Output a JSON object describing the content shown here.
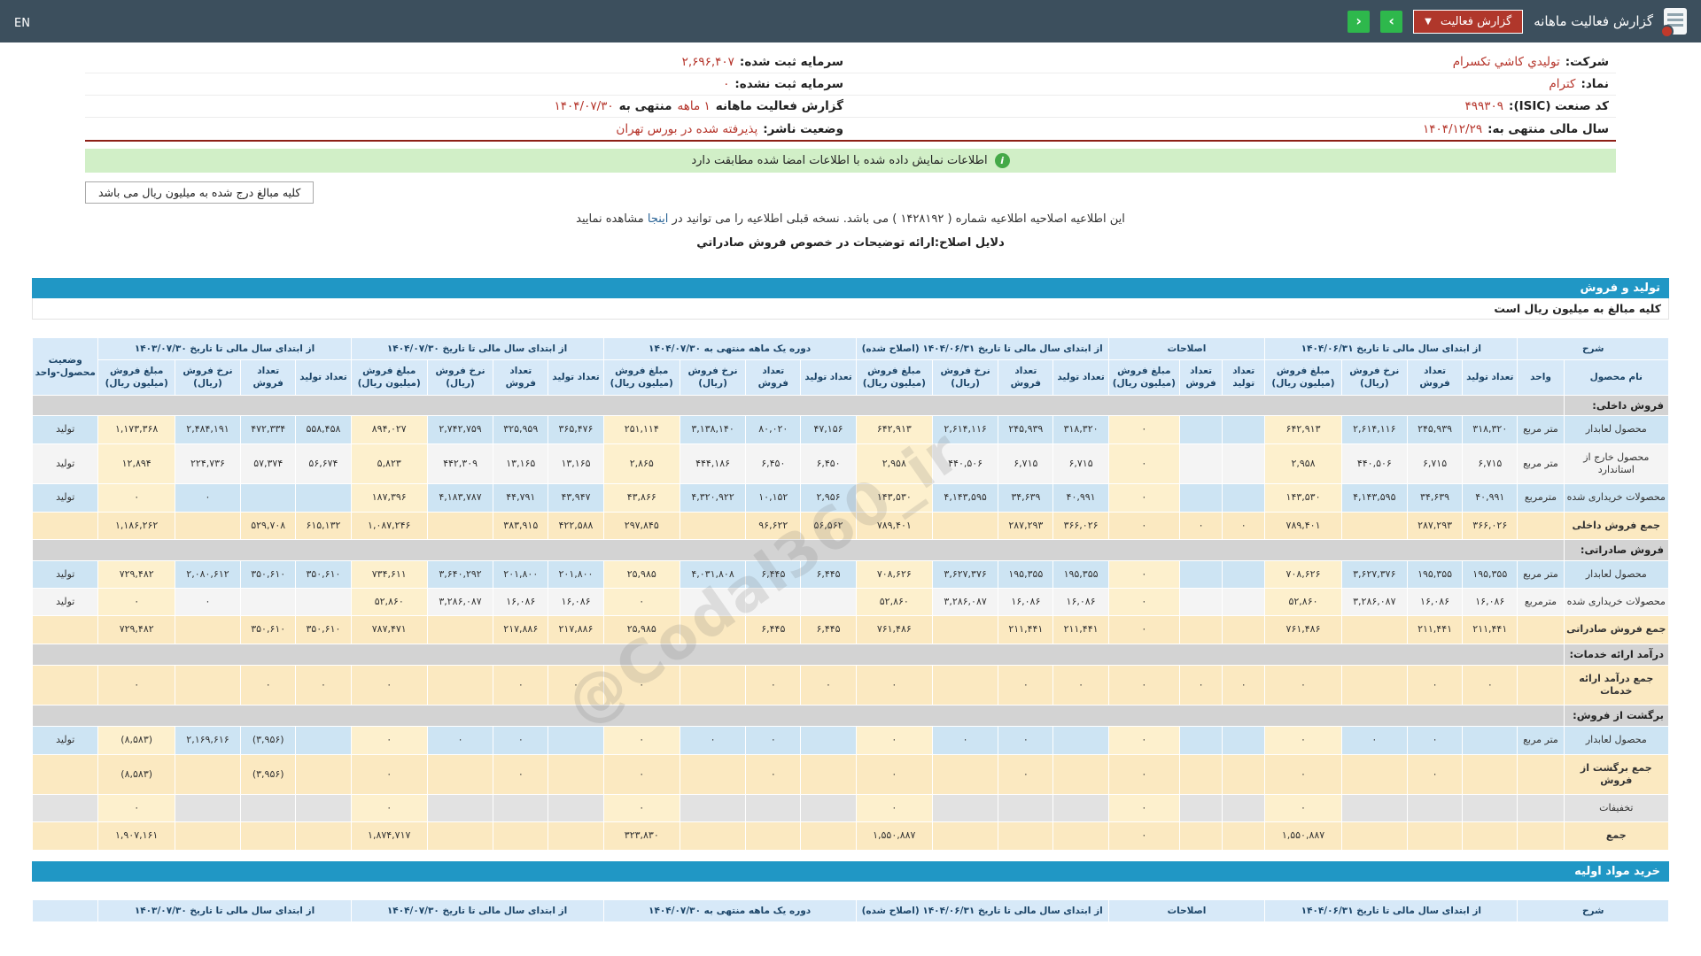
{
  "topbar": {
    "title": "گزارش فعالیت ماهانه",
    "dropdown_label": "گزارش فعالیت",
    "next_label": "›",
    "prev_label": "‹",
    "lang": "EN"
  },
  "info": {
    "company": {
      "label": "شرکت:",
      "value": "توليدي كاشي تكسرام"
    },
    "symbol": {
      "label": "نماد:",
      "value": "كترام"
    },
    "isic": {
      "label": "کد صنعت (ISIC):",
      "value": "۴۹۹۳۰۹"
    },
    "fiscal_year": {
      "label": "سال مالی منتهی به:",
      "value": "۱۴۰۴/۱۲/۲۹"
    },
    "registered_capital": {
      "label": "سرمایه ثبت شده:",
      "value": "۲,۶۹۶,۴۰۷"
    },
    "unregistered_capital": {
      "label": "سرمایه ثبت نشده:",
      "value": "۰"
    },
    "report": {
      "p1": "گزارش فعالیت ماهانه",
      "p2": "۱ ماهه",
      "p3": "منتهی به",
      "p4": "۱۴۰۴/۰۷/۳۰"
    },
    "publisher_status": {
      "label": "وضعیت ناشر:",
      "value": "پذيرفته شده در بورس تهران"
    }
  },
  "banner": {
    "text": "اطلاعات نمایش داده شده با اطلاعات امضا شده مطابقت دارد"
  },
  "amounts_note": "کلیه مبالغ درج شده به میلیون ریال می باشد",
  "notice": {
    "pre": "این اطلاعیه اصلاحیه اطلاعیه شماره ( ۱۴۲۸۱۹۲ ) می باشد. نسخه قبلی اطلاعیه را می توانید در ",
    "link_text": "اینجا",
    "post": " مشاهده نمایید"
  },
  "reason": "دلایل اصلاح:ارائه توضیحات در خصوص فروش صادراتي",
  "watermark": "@Codal360_ir",
  "production": {
    "title": "تولید و فروش",
    "note": "کلیه مبالغ به میلیون ریال است",
    "table": {
      "desc_header": "شرح",
      "name_header": "نام محصول",
      "unit_header": "واحد",
      "status_header": "وضعیت محصول-واحد",
      "groups": [
        {
          "label": "از ابتدای سال مالی تا تاریخ ۱۴۰۴/۰۶/۳۱",
          "cols": [
            "تعداد تولید",
            "تعداد فروش",
            "نرخ فروش (ریال)",
            "مبلغ فروش (میلیون ریال)"
          ]
        },
        {
          "label": "اصلاحات",
          "cols": [
            "تعداد تولید",
            "تعداد فروش",
            "مبلغ فروش (میلیون ریال)"
          ]
        },
        {
          "label": "از ابتدای سال مالی تا تاریخ ۱۴۰۴/۰۶/۳۱ (اصلاح شده)",
          "cols": [
            "تعداد تولید",
            "تعداد فروش",
            "نرخ فروش (ریال)",
            "مبلغ فروش (میلیون ریال)"
          ]
        },
        {
          "label": "دوره یک ماهه منتهی به ۱۴۰۴/۰۷/۳۰",
          "cols": [
            "تعداد تولید",
            "تعداد فروش",
            "نرخ فروش (ریال)",
            "مبلغ فروش (میلیون ریال)"
          ]
        },
        {
          "label": "از ابتدای سال مالی تا تاریخ ۱۴۰۴/۰۷/۳۰",
          "cols": [
            "تعداد تولید",
            "تعداد فروش",
            "نرخ فروش (ریال)",
            "مبلغ فروش (میلیون ریال)"
          ]
        },
        {
          "label": "از ابتدای سال مالی تا تاریخ ۱۴۰۳/۰۷/۳۰",
          "cols": [
            "تعداد تولید",
            "تعداد فروش",
            "نرخ فروش (ریال)",
            "مبلغ فروش (میلیون ریال)"
          ]
        }
      ],
      "rows": [
        {
          "type": "section",
          "label": "فروش داخلی:"
        },
        {
          "type": "data",
          "tint": "blue",
          "name": "محصول لعابدار",
          "unit": "متر مربع",
          "status": "تولید",
          "cells": [
            "۳۱۸,۳۲۰",
            "۲۴۵,۹۳۹",
            "۲,۶۱۴,۱۱۶",
            "۶۴۲,۹۱۳",
            "",
            "",
            "۰",
            "۳۱۸,۳۲۰",
            "۲۴۵,۹۳۹",
            "۲,۶۱۴,۱۱۶",
            "۶۴۲,۹۱۳",
            "۴۷,۱۵۶",
            "۸۰,۰۲۰",
            "۳,۱۳۸,۱۴۰",
            "۲۵۱,۱۱۴",
            "۳۶۵,۴۷۶",
            "۳۲۵,۹۵۹",
            "۲,۷۴۲,۷۵۹",
            "۸۹۴,۰۲۷",
            "۵۵۸,۴۵۸",
            "۴۷۲,۳۳۴",
            "۲,۴۸۴,۱۹۱",
            "۱,۱۷۳,۳۶۸"
          ]
        },
        {
          "type": "data",
          "tint": "white",
          "name": "محصول خارج از استاندارد",
          "unit": "متر مربع",
          "status": "تولید",
          "cells": [
            "۶,۷۱۵",
            "۶,۷۱۵",
            "۴۴۰,۵۰۶",
            "۲,۹۵۸",
            "",
            "",
            "۰",
            "۶,۷۱۵",
            "۶,۷۱۵",
            "۴۴۰,۵۰۶",
            "۲,۹۵۸",
            "۶,۴۵۰",
            "۶,۴۵۰",
            "۴۴۴,۱۸۶",
            "۲,۸۶۵",
            "۱۳,۱۶۵",
            "۱۳,۱۶۵",
            "۴۴۲,۳۰۹",
            "۵,۸۲۳",
            "۵۶,۶۷۴",
            "۵۷,۳۷۴",
            "۲۲۴,۷۳۶",
            "۱۲,۸۹۴"
          ]
        },
        {
          "type": "data",
          "tint": "blue",
          "name": "محصولات خریداری شده",
          "unit": "مترمربع",
          "status": "تولید",
          "cells": [
            "۴۰,۹۹۱",
            "۳۴,۶۳۹",
            "۴,۱۴۳,۵۹۵",
            "۱۴۳,۵۳۰",
            "",
            "",
            "۰",
            "۴۰,۹۹۱",
            "۳۴,۶۳۹",
            "۴,۱۴۳,۵۹۵",
            "۱۴۳,۵۳۰",
            "۲,۹۵۶",
            "۱۰,۱۵۲",
            "۴,۳۲۰,۹۲۲",
            "۴۳,۸۶۶",
            "۴۳,۹۴۷",
            "۴۴,۷۹۱",
            "۴,۱۸۳,۷۸۷",
            "۱۸۷,۳۹۶",
            "",
            "",
            "۰",
            "۰"
          ]
        },
        {
          "type": "sum",
          "name": "جمع فروش داخلی",
          "unit": "",
          "status": "",
          "cells": [
            "۳۶۶,۰۲۶",
            "۲۸۷,۲۹۳",
            "",
            "۷۸۹,۴۰۱",
            "۰",
            "۰",
            "۰",
            "۳۶۶,۰۲۶",
            "۲۸۷,۲۹۳",
            "",
            "۷۸۹,۴۰۱",
            "۵۶,۵۶۲",
            "۹۶,۶۲۲",
            "",
            "۲۹۷,۸۴۵",
            "۴۲۲,۵۸۸",
            "۳۸۳,۹۱۵",
            "",
            "۱,۰۸۷,۲۴۶",
            "۶۱۵,۱۳۲",
            "۵۲۹,۷۰۸",
            "",
            "۱,۱۸۶,۲۶۲"
          ]
        },
        {
          "type": "section",
          "label": "فروش صادراتی:"
        },
        {
          "type": "data",
          "tint": "blue",
          "name": "محصول لعابدار",
          "unit": "متر مربع",
          "status": "تولید",
          "cells": [
            "۱۹۵,۳۵۵",
            "۱۹۵,۳۵۵",
            "۳,۶۲۷,۳۷۶",
            "۷۰۸,۶۲۶",
            "",
            "",
            "۰",
            "۱۹۵,۳۵۵",
            "۱۹۵,۳۵۵",
            "۳,۶۲۷,۳۷۶",
            "۷۰۸,۶۲۶",
            "۶,۴۴۵",
            "۶,۴۴۵",
            "۴,۰۳۱,۸۰۸",
            "۲۵,۹۸۵",
            "۲۰۱,۸۰۰",
            "۲۰۱,۸۰۰",
            "۳,۶۴۰,۲۹۲",
            "۷۳۴,۶۱۱",
            "۳۵۰,۶۱۰",
            "۳۵۰,۶۱۰",
            "۲,۰۸۰,۶۱۲",
            "۷۲۹,۴۸۲"
          ]
        },
        {
          "type": "data",
          "tint": "white",
          "name": "محصولات خریداری شده",
          "unit": "مترمربع",
          "status": "تولید",
          "cells": [
            "۱۶,۰۸۶",
            "۱۶,۰۸۶",
            "۳,۲۸۶,۰۸۷",
            "۵۲,۸۶۰",
            "",
            "",
            "۰",
            "۱۶,۰۸۶",
            "۱۶,۰۸۶",
            "۳,۲۸۶,۰۸۷",
            "۵۲,۸۶۰",
            "",
            "",
            "",
            "۰",
            "۱۶,۰۸۶",
            "۱۶,۰۸۶",
            "۳,۲۸۶,۰۸۷",
            "۵۲,۸۶۰",
            "",
            "",
            "۰",
            "۰"
          ]
        },
        {
          "type": "sum",
          "name": "جمع فروش صادراتی",
          "unit": "",
          "status": "",
          "cells": [
            "۲۱۱,۴۴۱",
            "۲۱۱,۴۴۱",
            "",
            "۷۶۱,۴۸۶",
            "",
            "",
            "۰",
            "۲۱۱,۴۴۱",
            "۲۱۱,۴۴۱",
            "",
            "۷۶۱,۴۸۶",
            "۶,۴۴۵",
            "۶,۴۴۵",
            "",
            "۲۵,۹۸۵",
            "۲۱۷,۸۸۶",
            "۲۱۷,۸۸۶",
            "",
            "۷۸۷,۴۷۱",
            "۳۵۰,۶۱۰",
            "۳۵۰,۶۱۰",
            "",
            "۷۲۹,۴۸۲"
          ]
        },
        {
          "type": "section",
          "label": "درآمد ارائه خدمات:"
        },
        {
          "type": "sum",
          "name": "جمع درآمد ارائه خدمات",
          "unit": "",
          "status": "",
          "cells": [
            "۰",
            "۰",
            "",
            "۰",
            "۰",
            "۰",
            "۰",
            "۰",
            "۰",
            "",
            "۰",
            "۰",
            "۰",
            "",
            "۰",
            "۰",
            "۰",
            "",
            "۰",
            "۰",
            "۰",
            "",
            "۰"
          ]
        },
        {
          "type": "section",
          "label": "برگشت از فروش:"
        },
        {
          "type": "data",
          "tint": "blue",
          "name": "محصول لعابدار",
          "unit": "متر مربع",
          "status": "تولید",
          "cells": [
            "",
            "۰",
            "۰",
            "۰",
            "",
            "",
            "۰",
            "",
            "۰",
            "۰",
            "۰",
            "",
            "۰",
            "۰",
            "۰",
            "",
            "۰",
            "۰",
            "۰",
            "",
            "(۳,۹۵۶)",
            "۲,۱۶۹,۶۱۶",
            "(۸,۵۸۳)"
          ]
        },
        {
          "type": "sum",
          "name": "جمع برگشت از فروش",
          "unit": "",
          "status": "",
          "cells": [
            "",
            "۰",
            "",
            "۰",
            "",
            "",
            "۰",
            "",
            "۰",
            "",
            "۰",
            "",
            "۰",
            "",
            "۰",
            "",
            "۰",
            "",
            "۰",
            "",
            "(۳,۹۵۶)",
            "",
            "(۸,۵۸۳)"
          ]
        },
        {
          "type": "data",
          "tint": "gray",
          "name": "تخفیفات",
          "unit": "",
          "status": "",
          "cells": [
            "",
            "",
            "",
            "۰",
            "",
            "",
            "۰",
            "",
            "",
            "",
            "۰",
            "",
            "",
            "",
            "۰",
            "",
            "",
            "",
            "۰",
            "",
            "",
            "",
            "۰"
          ]
        },
        {
          "type": "sum",
          "name": "جمع",
          "unit": "",
          "status": "",
          "cells": [
            "",
            "",
            "",
            "۱,۵۵۰,۸۸۷",
            "",
            "",
            "۰",
            "",
            "",
            "",
            "۱,۵۵۰,۸۸۷",
            "",
            "",
            "",
            "۳۲۳,۸۳۰",
            "",
            "",
            "",
            "۱,۸۷۴,۷۱۷",
            "",
            "",
            "",
            "۱,۹۰۷,۱۶۱"
          ]
        }
      ]
    }
  },
  "materials": {
    "title": "خرید مواد اولیه",
    "desc_header": "شرح"
  }
}
